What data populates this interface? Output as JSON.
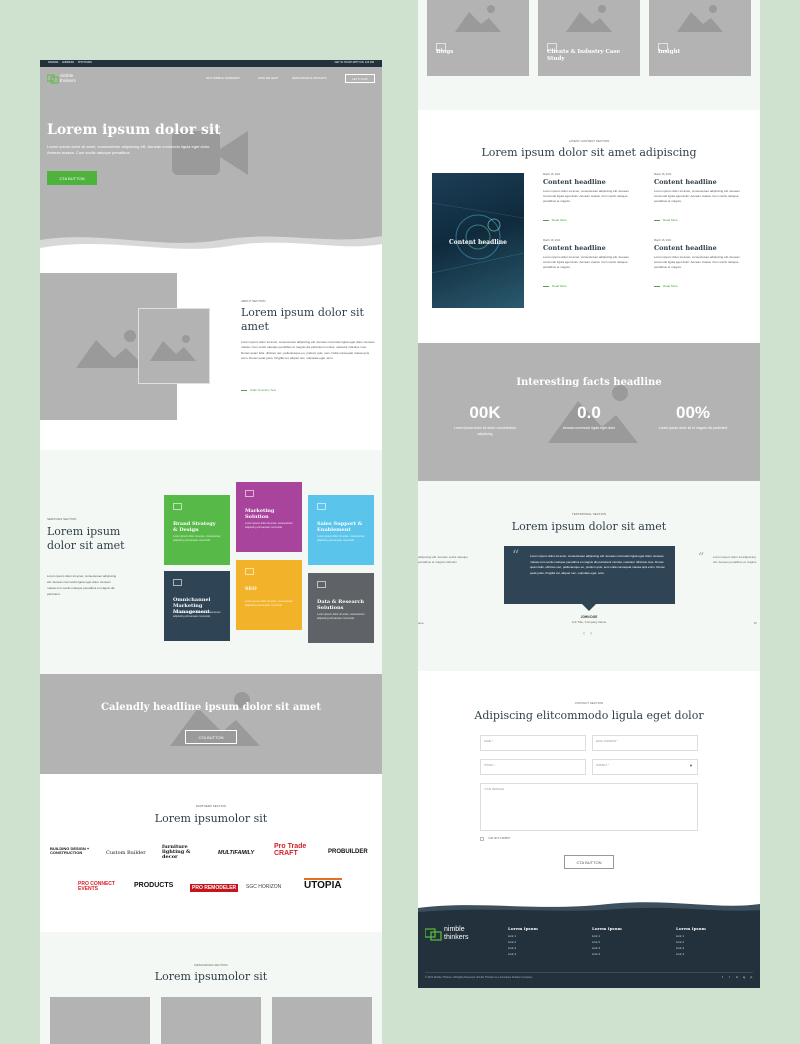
{
  "left": {
    "topbar": {
      "links": [
        "SANDRA",
        "ANDRESS",
        "PHOTOVES"
      ],
      "right": "GET IN TOUCH WITH US: 123 456"
    },
    "brand": {
      "line1": "nimble",
      "line2": "thinkers"
    },
    "nav": [
      "WHY NIMBLE THINKERS?",
      "HOW WE HELP",
      "RESOURCES & INSIGHTS"
    ],
    "nav_cta": "LET'S CHAT",
    "hero": {
      "title": "Lorem ipsum dolor sit",
      "text": "Lorem ipsum dolor sit amet, consectetuer adipiscing elit. Aenean commodo ligula eget dolor. Aenean massa. Cum sociis natoque penatibus.",
      "cta": "CTA BUTTON"
    },
    "about": {
      "kicker": "ABOUT SECTION",
      "title": "Lorem ipsum dolor sit amet",
      "text": "Lorem ipsum dolor sit amet, consectetuer adipiscing elit. Aenean commodo ligula eget dolor. Aenean massa. Cum sociis natoque penatibus et magnis dis parturient montes, nascetur ridiculus mus. Donec quam felis, ultricies nec, pellentesque eu, pretium quis, sem. Nulla consequat massa quis enim. Donec pede justo, fringilla vel, aliquet nec, vulputate eget, arcu.",
      "link": "Calls To Action Text"
    },
    "services": {
      "kicker": "SERVICES SECTION",
      "title": "Lorem ipsum dolor sit amet",
      "text": "Lorem ipsum dolor sit amet, consectetuer adipiscing elit. Aenean commodo ligula eget dolor. Aenean massa cum sociis natoque penatibus et magnis dis parturient.",
      "tiles": [
        {
          "title": "Brand Strategy & Design",
          "color": "#57b947",
          "desc": "Lorem ipsum dolor sit amet, consectetuer adipiscing elit aenean commodo."
        },
        {
          "title": "Marketing Solution",
          "color": "#a9449d",
          "desc": "Lorem ipsum dolor sit amet, consectetuer adipiscing elit aenean commodo."
        },
        {
          "title": "Sales Support & Enablement",
          "color": "#5bc4ea",
          "desc": "Lorem ipsum dolor sit amet, consectetuer adipiscing elit aenean commodo."
        },
        {
          "title": "Omnichannel Marketing Management",
          "color": "#2f4454",
          "desc": "Lorem ipsum dolor sit amet, consectetuer adipiscing elit aenean commodo."
        },
        {
          "title": "SEO",
          "color": "#f2b229",
          "desc": "Lorem ipsum dolor sit amet, consectetuer adipiscing elit aenean commodo."
        },
        {
          "title": "Data & Research Solutions",
          "color": "#5f6367",
          "desc": "Lorem ipsum dolor sit amet, consectetuer adipiscing elit aenean commodo."
        }
      ]
    },
    "calendly": {
      "title": "Calendly headline ipsum dolor sit amet",
      "cta": "CTA BUTTON"
    },
    "partners": {
      "kicker": "PARTNERS SECTION",
      "title": "Lorem ipsumolor sit",
      "logos": [
        "BUILDING DESIGN + CONSTRUCTION",
        "Custom Builder",
        "furniture lighting & decor",
        "MULTIFAMILY",
        "Pro Trade CRAFT",
        "PROBUILDER",
        "PRO CONNECT EVENTS",
        "PRODUCTS",
        "PRO REMODELER",
        "SGC HORIZON",
        "UTOPIA"
      ]
    },
    "resources": {
      "kicker": "RESOURCES SECTION",
      "title": "Lorem ipsumolor sit"
    }
  },
  "right": {
    "cards": [
      "Blogs",
      "Clients & Industry Case Study",
      "Insight"
    ],
    "content": {
      "kicker": "LATEST CONTENT SECTION",
      "title": "Lorem ipsum dolor sit amet adipiscing",
      "feature_label": "Content headline",
      "items": [
        {
          "date": "March 18, 2021",
          "title": "Content headline",
          "text": "Lorem ipsum dolor sit amet, consectetuer adipiscing elit. Aenean commodo ligula eget dolor. Aenean massa. Cum sociis natoque penatibus et magnis.",
          "link": "Read More"
        },
        {
          "date": "March 18, 2021",
          "title": "Content headline",
          "text": "Lorem ipsum dolor sit amet, consectetuer adipiscing elit. Aenean commodo ligula eget dolor. Aenean massa. Cum sociis natoque penatibus et magnis.",
          "link": "Read More"
        },
        {
          "date": "March 18, 2021",
          "title": "Content headline",
          "text": "Lorem ipsum dolor sit amet, consectetuer adipiscing elit. Aenean commodo ligula eget dolor. Aenean massa. Cum sociis natoque penatibus et magnis.",
          "link": "Read More"
        },
        {
          "date": "March 18, 2021",
          "title": "Content headline",
          "text": "Lorem ipsum dolor sit amet, consectetuer adipiscing elit. Aenean commodo ligula eget dolor. Aenean massa. Cum sociis natoque penatibus et magnis.",
          "link": "Read More"
        }
      ]
    },
    "facts": {
      "title": "Interesting facts headline",
      "items": [
        {
          "value": "00K",
          "text": "Lorem ipsum dolor sit amet, consectetuer adipiscing"
        },
        {
          "value": "0.0",
          "text": "Aenean commodo ligula eget dolor"
        },
        {
          "value": "00%",
          "text": "Lorem ipsum dolor sit et magnis dis partarient"
        }
      ]
    },
    "testimonial": {
      "kicker": "TESTIMONIAL SECTION",
      "title": "Lorem ipsum dolor sit amet",
      "quote": "Lorem ipsum dolor sit amet, consectetuer adipiscing elit. Aenean commodo ligula eget dolor. Aenean massa cum sociis natoque penatibus et magnis dis parturient montes, nascetur ridiculus mus. Donec quam felis, ultricies nec, pellentesque eu, pretium quis, sem nulla consequat massa quis enim. Donec pede justo, fringilla vel, aliquet nec, vulputate eget, arcu.",
      "left_peek": "adipiscing elit. Aenean sociis natoque penatibus et magnis ridiculus",
      "right_peek": "Lorem ipsum dolor sit adipiscing elit. Aenean penatibus et magnis",
      "name": "JOHN DOE",
      "role": "Job Title, Company Name",
      "left_name": "ame",
      "right_name": "M"
    },
    "contact": {
      "kicker": "CONTACT SECTION",
      "title": "Adipiscing elitcommodo ligula eget dolor",
      "fields": [
        "NAME *",
        "EMAIL ADDRESS *",
        "PHONE *",
        "SUBJECT *",
        "YOUR MESSAGE"
      ],
      "checkbox": "I AM NOT A ROBOT",
      "cta": "CTA BUTTON"
    },
    "footer": {
      "brand1": "nimble",
      "brand2": "thinkers",
      "columns": [
        {
          "title": "Lorem Ipsum",
          "links": [
            "Link 1",
            "Link 2",
            "Link 3",
            "Link 4"
          ]
        },
        {
          "title": "Lorem Ipsum",
          "links": [
            "Link 1",
            "Link 2",
            "Link 3",
            "Link 4"
          ]
        },
        {
          "title": "Lorem Ipsum",
          "links": [
            "Link 1",
            "Link 2",
            "Link 3",
            "Link 4"
          ]
        }
      ],
      "copyright": "© 2021 Nimble Thinkers. All Rights Reserved. Nimble Thinkers is a Innovative Solution Company.",
      "social": [
        "f",
        "t",
        "in",
        "ig",
        "yt"
      ]
    }
  }
}
